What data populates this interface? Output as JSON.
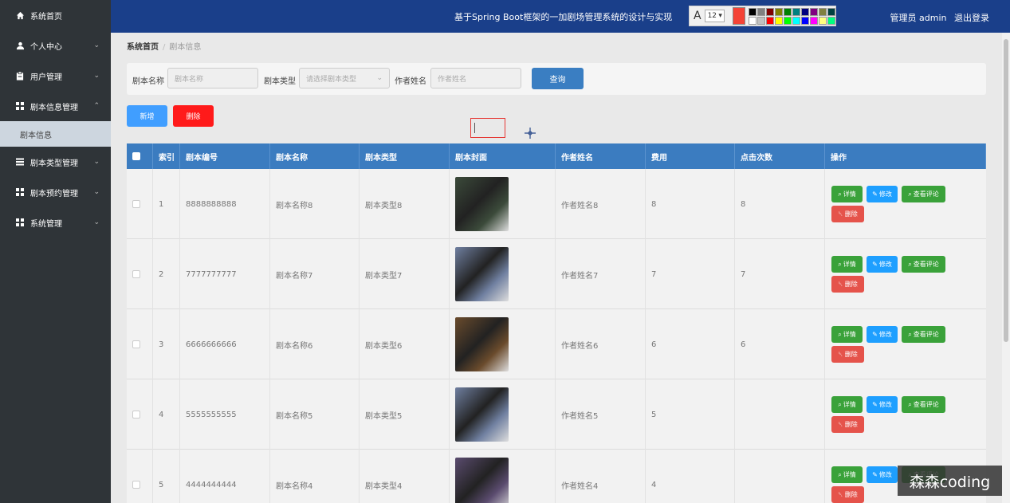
{
  "sidebar": {
    "items": [
      {
        "label": "系统首页",
        "icon": "home-icon"
      },
      {
        "label": "个人中心",
        "icon": "user-icon"
      },
      {
        "label": "用户管理",
        "icon": "clipboard-icon"
      },
      {
        "label": "剧本信息管理",
        "icon": "grid-icon"
      },
      {
        "label": "剧本类型管理",
        "icon": "menu-icon"
      },
      {
        "label": "剧本预约管理",
        "icon": "grid-icon"
      },
      {
        "label": "系统管理",
        "icon": "grid-icon"
      }
    ],
    "active_sub": "剧本信息"
  },
  "header": {
    "title": "基于Spring Boot框架的一加剧场管理系统的设计与实现",
    "user_label": "管理员 admin",
    "logout": "退出登录"
  },
  "toolbar": {
    "font_size": "12",
    "current_color": "#f44336",
    "palette": [
      "#000000",
      "#808080",
      "#800000",
      "#808000",
      "#008000",
      "#008080",
      "#000080",
      "#800080",
      "#808040",
      "#004040",
      "#ffffff",
      "#c0c0c0",
      "#ff0000",
      "#ffff00",
      "#00ff00",
      "#00ffff",
      "#0000ff",
      "#ff00ff",
      "#ffff80",
      "#00ff80"
    ]
  },
  "breadcrumb": {
    "home": "系统首页",
    "current": "剧本信息"
  },
  "search": {
    "name_label": "剧本名称",
    "name_placeholder": "剧本名称",
    "type_label": "剧本类型",
    "type_placeholder": "请选择剧本类型",
    "author_label": "作者姓名",
    "author_placeholder": "作者姓名",
    "query_button": "查询"
  },
  "actions": {
    "add": "新增",
    "delete": "删除"
  },
  "table": {
    "headers": [
      "",
      "索引",
      "剧本编号",
      "剧本名称",
      "剧本类型",
      "剧本封面",
      "作者姓名",
      "费用",
      "点击次数",
      "操作"
    ],
    "rows": [
      {
        "index": "1",
        "code": "8888888888",
        "name": "剧本名称8",
        "type": "剧本类型8",
        "author": "作者姓名8",
        "fee": "8",
        "clicks": "8",
        "thumb": "#3b4a3a"
      },
      {
        "index": "2",
        "code": "7777777777",
        "name": "剧本名称7",
        "type": "剧本类型7",
        "author": "作者姓名7",
        "fee": "7",
        "clicks": "7",
        "thumb": "#6f7fa0"
      },
      {
        "index": "3",
        "code": "6666666666",
        "name": "剧本名称6",
        "type": "剧本类型6",
        "author": "作者姓名6",
        "fee": "6",
        "clicks": "6",
        "thumb": "#6a4b2c"
      },
      {
        "index": "4",
        "code": "5555555555",
        "name": "剧本名称5",
        "type": "剧本类型5",
        "author": "作者姓名5",
        "fee": "5",
        "clicks": "",
        "thumb": "#6f7fa0"
      },
      {
        "index": "5",
        "code": "4444444444",
        "name": "剧本名称4",
        "type": "剧本类型4",
        "author": "作者姓名4",
        "fee": "4",
        "clicks": "",
        "thumb": "#5a4b6e"
      }
    ],
    "op_labels": {
      "detail": "详情",
      "edit": "修改",
      "comments": "查看评论",
      "delete": "删除"
    }
  },
  "watermark": "森森coding"
}
